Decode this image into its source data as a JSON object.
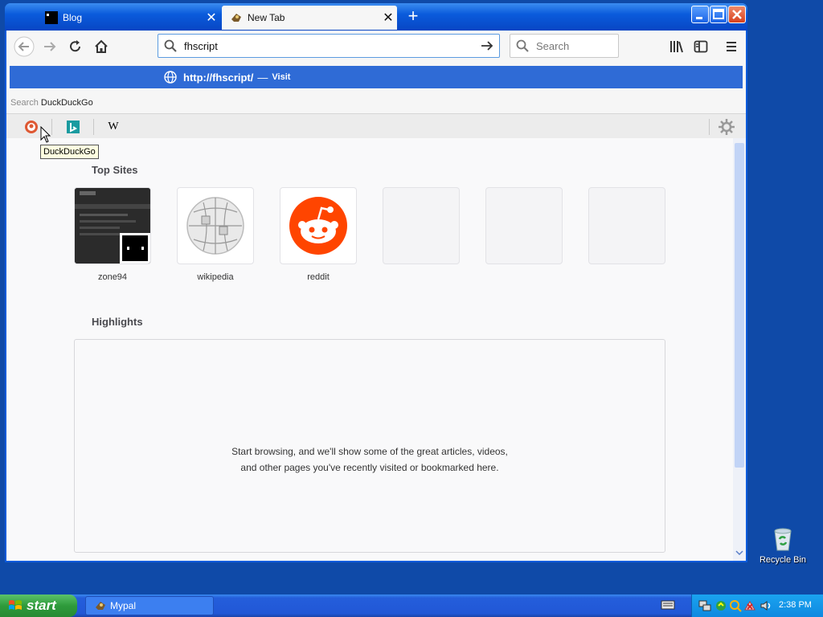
{
  "window": {
    "tabs": [
      {
        "title": "Blog",
        "close": "✕"
      },
      {
        "title": "New Tab",
        "close": "✕"
      }
    ],
    "new_tab": "+"
  },
  "navbar": {
    "url_value": "fhscript",
    "search_placeholder": "Search"
  },
  "suggestion": {
    "url": "http://fhscript/",
    "separator": "—",
    "action": "Visit"
  },
  "search_with": {
    "prefix": "Search",
    "engine": "DuckDuckGo"
  },
  "engines": [
    {
      "name": "DuckDuckGo",
      "icon": "duckduckgo-icon"
    },
    {
      "name": "Bing",
      "icon": "bing-icon"
    },
    {
      "name": "Wikipedia",
      "icon": "wikipedia-icon",
      "glyph": "W"
    }
  ],
  "tooltip": "DuckDuckGo",
  "top_sites": {
    "heading": "Top Sites",
    "sites": [
      {
        "label": "zone94"
      },
      {
        "label": "wikipedia"
      },
      {
        "label": "reddit"
      },
      {
        "label": ""
      },
      {
        "label": ""
      },
      {
        "label": ""
      }
    ]
  },
  "highlights": {
    "heading": "Highlights",
    "message": "Start browsing, and we'll show some of the great articles, videos, and other pages you've recently visited or bookmarked here."
  },
  "desktop": {
    "recycle_bin": "Recycle Bin"
  },
  "taskbar": {
    "start": "start",
    "task": "Mypal",
    "clock": "2:38 PM"
  },
  "colors": {
    "accent": "#2f6bd6",
    "reddit": "#ff4500",
    "taskbar": "#245edb",
    "start": "#2e9b3b"
  }
}
